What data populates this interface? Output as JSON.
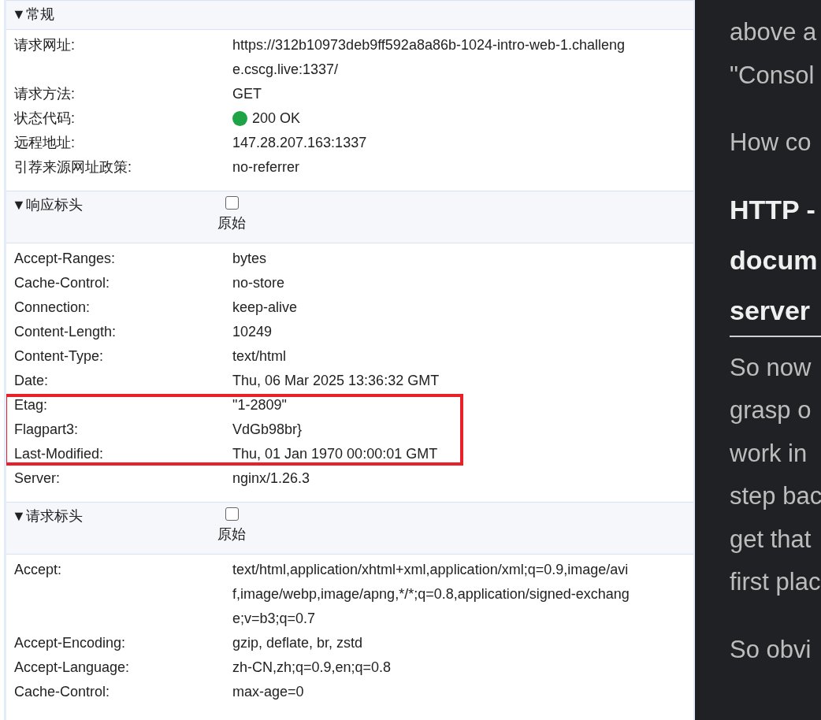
{
  "sections": [
    {
      "marker": "▼",
      "title": "常规",
      "rows": [
        {
          "label": "请求网址:",
          "value": "https://312b10973deb9ff592a8a86b-1024-intro-web-1.challenge.cscg.live:1337/",
          "kind": "text"
        },
        {
          "label": "请求方法:",
          "value": "GET",
          "kind": "text"
        },
        {
          "label": "状态代码:",
          "value": "200 OK",
          "kind": "status"
        },
        {
          "label": "远程地址:",
          "value": "147.28.207.163:1337",
          "kind": "text"
        },
        {
          "label": "引荐来源网址政策:",
          "value": "no-referrer",
          "kind": "text"
        }
      ]
    },
    {
      "marker": "▼",
      "title": "响应标头",
      "raw": {
        "label": "原始",
        "checked": false
      },
      "rows": [
        {
          "label": "Accept-Ranges:",
          "value": "bytes",
          "kind": "text"
        },
        {
          "label": "Cache-Control:",
          "value": "no-store",
          "kind": "text"
        },
        {
          "label": "Connection:",
          "value": "keep-alive",
          "kind": "text"
        },
        {
          "label": "Content-Length:",
          "value": "10249",
          "kind": "text"
        },
        {
          "label": "Content-Type:",
          "value": "text/html",
          "kind": "text"
        },
        {
          "label": "Date:",
          "value": "Thu, 06 Mar 2025 13:36:32 GMT",
          "kind": "text"
        },
        {
          "label": "Etag:",
          "value": "\"1-2809\"",
          "kind": "text",
          "highlighted": true
        },
        {
          "label": "Flagpart3:",
          "value": "VdGb98br}",
          "kind": "text",
          "highlighted": true
        },
        {
          "label": "Last-Modified:",
          "value": "Thu, 01 Jan 1970 00:00:01 GMT",
          "kind": "text",
          "highlighted": true
        },
        {
          "label": "Server:",
          "value": "nginx/1.26.3",
          "kind": "text"
        }
      ]
    },
    {
      "marker": "▼",
      "title": "请求标头",
      "raw": {
        "label": "原始",
        "checked": false
      },
      "rows": [
        {
          "label": "Accept:",
          "value": "text/html,application/xhtml+xml,application/xml;q=0.9,image/avif,image/webp,image/apng,*/*;q=0.8,application/signed-exchange;v=b3;q=0.7",
          "kind": "text"
        },
        {
          "label": "Accept-Encoding:",
          "value": "gzip, deflate, br, zstd",
          "kind": "text"
        },
        {
          "label": "Accept-Language:",
          "value": "zh-CN,zh;q=0.9,en;q=0.8",
          "kind": "text"
        },
        {
          "label": "Cache-Control:",
          "value": "max-age=0",
          "kind": "text"
        }
      ]
    }
  ],
  "article": [
    {
      "kind": "para",
      "lines": [
        "above a",
        "\"Consol"
      ]
    },
    {
      "kind": "para",
      "lines": [
        "How co"
      ]
    },
    {
      "kind": "heading",
      "lines": [
        "HTTP -",
        "docum",
        "server"
      ]
    },
    {
      "kind": "para",
      "lines": [
        "So now",
        "grasp o",
        "work in",
        "step bac",
        "get that",
        "first plac"
      ]
    },
    {
      "kind": "para",
      "lines": [
        "So obvi"
      ]
    }
  ]
}
